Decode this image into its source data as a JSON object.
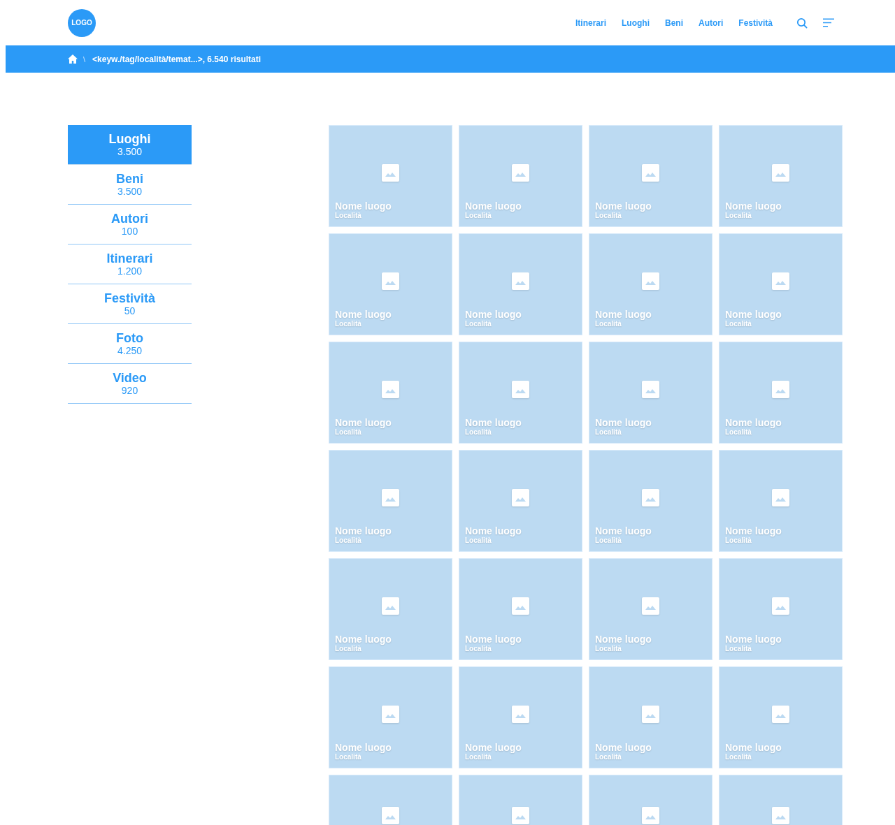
{
  "header": {
    "logo": "LOGO",
    "nav": [
      "Itinerari",
      "Luoghi",
      "Beni",
      "Autori",
      "Festività"
    ]
  },
  "breadcrumb": {
    "separator": "\\",
    "text": "<keyw./tag/località/temat...>, 6.540 risultati"
  },
  "categories": [
    {
      "label": "Luoghi",
      "count": "3.500",
      "selected": true
    },
    {
      "label": "Beni",
      "count": "3.500",
      "selected": false
    },
    {
      "label": "Autori",
      "count": "100",
      "selected": false
    },
    {
      "label": "Itinerari",
      "count": "1.200",
      "selected": false
    },
    {
      "label": "Festività",
      "count": "50",
      "selected": false
    },
    {
      "label": "Foto",
      "count": "4.250",
      "selected": false
    },
    {
      "label": "Video",
      "count": "920",
      "selected": false
    }
  ],
  "results": [
    {
      "name": "Nome luogo",
      "location": "Località"
    },
    {
      "name": "Nome luogo",
      "location": "Località"
    },
    {
      "name": "Nome luogo",
      "location": "Località"
    },
    {
      "name": "Nome luogo",
      "location": "Località"
    },
    {
      "name": "Nome luogo",
      "location": "Località"
    },
    {
      "name": "Nome luogo",
      "location": "Località"
    },
    {
      "name": "Nome luogo",
      "location": "Località"
    },
    {
      "name": "Nome luogo",
      "location": "Località"
    },
    {
      "name": "Nome luogo",
      "location": "Località"
    },
    {
      "name": "Nome luogo",
      "location": "Località"
    },
    {
      "name": "Nome luogo",
      "location": "Località"
    },
    {
      "name": "Nome luogo",
      "location": "Località"
    },
    {
      "name": "Nome luogo",
      "location": "Località"
    },
    {
      "name": "Nome luogo",
      "location": "Località"
    },
    {
      "name": "Nome luogo",
      "location": "Località"
    },
    {
      "name": "Nome luogo",
      "location": "Località"
    },
    {
      "name": "Nome luogo",
      "location": "Località"
    },
    {
      "name": "Nome luogo",
      "location": "Località"
    },
    {
      "name": "Nome luogo",
      "location": "Località"
    },
    {
      "name": "Nome luogo",
      "location": "Località"
    },
    {
      "name": "Nome luogo",
      "location": "Località"
    },
    {
      "name": "Nome luogo",
      "location": "Località"
    },
    {
      "name": "Nome luogo",
      "location": "Località"
    },
    {
      "name": "Nome luogo",
      "location": "Località"
    },
    {
      "kind": "cut"
    },
    {
      "kind": "cut"
    },
    {
      "kind": "cut"
    },
    {
      "kind": "cut"
    }
  ]
}
